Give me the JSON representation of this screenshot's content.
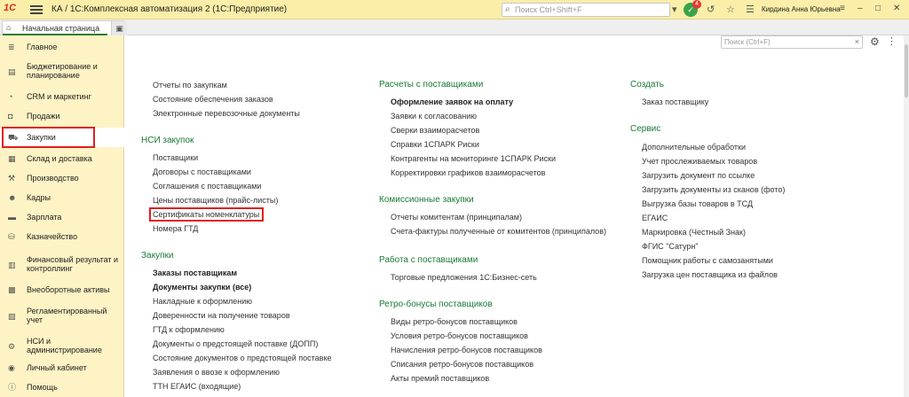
{
  "titlebar": {
    "logo": "1С",
    "title": "КА / 1С:Комплексная автоматизация 2  (1С:Предприятие)",
    "search_placeholder": "Поиск Ctrl+Shift+F",
    "notifications_count": "4",
    "user": "Кирдина Анна Юрьевна"
  },
  "tabs": {
    "home": "Начальная страница"
  },
  "sidebar": {
    "items": [
      {
        "icon": "list-icon",
        "label": "Главное"
      },
      {
        "icon": "chart-icon",
        "label": "Бюджетирование и планирование"
      },
      {
        "icon": "pie-icon",
        "label": "CRM и маркетинг"
      },
      {
        "icon": "bag-icon",
        "label": "Продажи"
      },
      {
        "icon": "cart-icon",
        "label": "Закупки"
      },
      {
        "icon": "warehouse-icon",
        "label": "Склад и доставка"
      },
      {
        "icon": "factory-icon",
        "label": "Производство"
      },
      {
        "icon": "person-icon",
        "label": "Кадры"
      },
      {
        "icon": "money-icon",
        "label": "Зарплата"
      },
      {
        "icon": "bank-icon",
        "label": "Казначейство"
      },
      {
        "icon": "finance-icon",
        "label": "Финансовый результат и контроллинг"
      },
      {
        "icon": "assets-icon",
        "label": "Внеоборотные активы"
      },
      {
        "icon": "report-icon",
        "label": "Регламентированный учет"
      },
      {
        "icon": "gear-icon",
        "label": "НСИ и администрирование"
      },
      {
        "icon": "user-icon",
        "label": "Личный кабинет"
      },
      {
        "icon": "help-icon",
        "label": "Помощь"
      }
    ]
  },
  "main": {
    "search_placeholder": "Поиск (Ctrl+F)",
    "col1": {
      "top_links": [
        "Отчеты по закупкам",
        "Состояние обеспечения заказов",
        "Электронные перевозочные документы"
      ],
      "nsi_title": "НСИ закупок",
      "nsi_links": [
        "Поставщики",
        "Договоры с поставщиками",
        "Соглашения с поставщиками",
        "Цены поставщиков (прайс-листы)",
        "Сертификаты номенклатуры",
        "Номера ГТД"
      ],
      "purch_title": "Закупки",
      "purch_links": [
        "Заказы поставщикам",
        "Документы закупки (все)",
        "Накладные к оформлению",
        "Доверенности на получение товаров",
        "ГТД к оформлению",
        "Документы о предстоящей поставке (ДОПП)",
        "Состояние документов о предстоящей поставке",
        "Заявления о ввозе к оформлению",
        "ТТН ЕГАИС (входящие)"
      ]
    },
    "col2": {
      "s1_title": "Расчеты с поставщиками",
      "s1_links": [
        "Оформление заявок на оплату",
        "Заявки к согласованию",
        "Сверки взаиморасчетов",
        "Справки 1СПАРК Риски",
        "Контрагенты на мониторинге 1СПАРК Риски",
        "Корректировки графиков взаиморасчетов"
      ],
      "s2_title": "Комиссионные закупки",
      "s2_links": [
        "Отчеты комитентам (принципалам)",
        "Счета-фактуры полученные от комитентов (принципалов)"
      ],
      "s3_title": "Работа с поставщиками",
      "s3_links": [
        "Торговые предложения 1С:Бизнес-сеть"
      ],
      "s4_title": "Ретро-бонусы поставщиков",
      "s4_links": [
        "Виды ретро-бонусов поставщиков",
        "Условия ретро-бонусов поставщиков",
        "Начисления ретро-бонусов поставщиков",
        "Списания ретро-бонусов поставщиков",
        "Акты премий поставщиков"
      ]
    },
    "col3": {
      "create_title": "Создать",
      "create_links": [
        "Заказ поставщику"
      ],
      "service_title": "Сервис",
      "service_links": [
        "Дополнительные обработки",
        "Учет прослеживаемых товаров",
        "Загрузить документ по ссылке",
        "Загрузить документы из сканов (фото)",
        "Выгрузка базы товаров в ТСД",
        "ЕГАИС",
        "Маркировка (Честный Знак)",
        "ФГИС \"Сатурн\"",
        "Помощник работы с самозанятыми",
        "Загрузка цен поставщика из файлов"
      ]
    }
  }
}
